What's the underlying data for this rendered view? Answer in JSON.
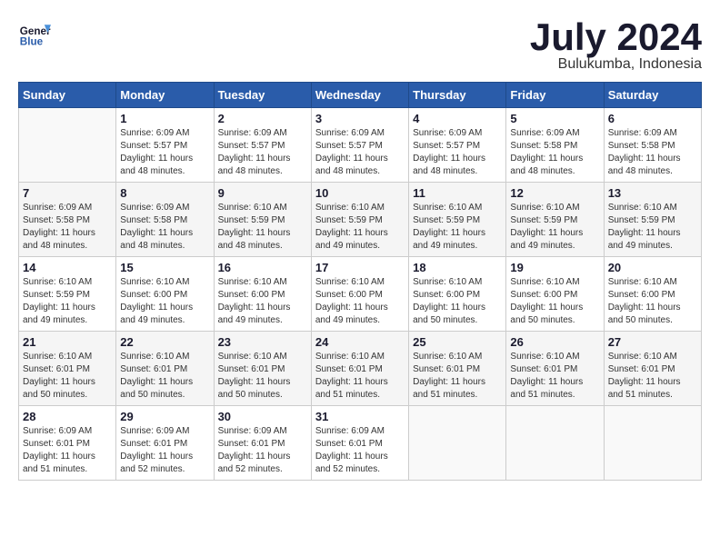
{
  "header": {
    "logo_line1": "General",
    "logo_line2": "Blue",
    "month": "July 2024",
    "location": "Bulukumba, Indonesia"
  },
  "weekdays": [
    "Sunday",
    "Monday",
    "Tuesday",
    "Wednesday",
    "Thursday",
    "Friday",
    "Saturday"
  ],
  "weeks": [
    [
      {
        "day": "",
        "info": ""
      },
      {
        "day": "1",
        "info": "Sunrise: 6:09 AM\nSunset: 5:57 PM\nDaylight: 11 hours\nand 48 minutes."
      },
      {
        "day": "2",
        "info": "Sunrise: 6:09 AM\nSunset: 5:57 PM\nDaylight: 11 hours\nand 48 minutes."
      },
      {
        "day": "3",
        "info": "Sunrise: 6:09 AM\nSunset: 5:57 PM\nDaylight: 11 hours\nand 48 minutes."
      },
      {
        "day": "4",
        "info": "Sunrise: 6:09 AM\nSunset: 5:57 PM\nDaylight: 11 hours\nand 48 minutes."
      },
      {
        "day": "5",
        "info": "Sunrise: 6:09 AM\nSunset: 5:58 PM\nDaylight: 11 hours\nand 48 minutes."
      },
      {
        "day": "6",
        "info": "Sunrise: 6:09 AM\nSunset: 5:58 PM\nDaylight: 11 hours\nand 48 minutes."
      }
    ],
    [
      {
        "day": "7",
        "info": "Sunrise: 6:09 AM\nSunset: 5:58 PM\nDaylight: 11 hours\nand 48 minutes."
      },
      {
        "day": "8",
        "info": "Sunrise: 6:09 AM\nSunset: 5:58 PM\nDaylight: 11 hours\nand 48 minutes."
      },
      {
        "day": "9",
        "info": "Sunrise: 6:10 AM\nSunset: 5:59 PM\nDaylight: 11 hours\nand 48 minutes."
      },
      {
        "day": "10",
        "info": "Sunrise: 6:10 AM\nSunset: 5:59 PM\nDaylight: 11 hours\nand 49 minutes."
      },
      {
        "day": "11",
        "info": "Sunrise: 6:10 AM\nSunset: 5:59 PM\nDaylight: 11 hours\nand 49 minutes."
      },
      {
        "day": "12",
        "info": "Sunrise: 6:10 AM\nSunset: 5:59 PM\nDaylight: 11 hours\nand 49 minutes."
      },
      {
        "day": "13",
        "info": "Sunrise: 6:10 AM\nSunset: 5:59 PM\nDaylight: 11 hours\nand 49 minutes."
      }
    ],
    [
      {
        "day": "14",
        "info": "Sunrise: 6:10 AM\nSunset: 5:59 PM\nDaylight: 11 hours\nand 49 minutes."
      },
      {
        "day": "15",
        "info": "Sunrise: 6:10 AM\nSunset: 6:00 PM\nDaylight: 11 hours\nand 49 minutes."
      },
      {
        "day": "16",
        "info": "Sunrise: 6:10 AM\nSunset: 6:00 PM\nDaylight: 11 hours\nand 49 minutes."
      },
      {
        "day": "17",
        "info": "Sunrise: 6:10 AM\nSunset: 6:00 PM\nDaylight: 11 hours\nand 49 minutes."
      },
      {
        "day": "18",
        "info": "Sunrise: 6:10 AM\nSunset: 6:00 PM\nDaylight: 11 hours\nand 50 minutes."
      },
      {
        "day": "19",
        "info": "Sunrise: 6:10 AM\nSunset: 6:00 PM\nDaylight: 11 hours\nand 50 minutes."
      },
      {
        "day": "20",
        "info": "Sunrise: 6:10 AM\nSunset: 6:00 PM\nDaylight: 11 hours\nand 50 minutes."
      }
    ],
    [
      {
        "day": "21",
        "info": "Sunrise: 6:10 AM\nSunset: 6:01 PM\nDaylight: 11 hours\nand 50 minutes."
      },
      {
        "day": "22",
        "info": "Sunrise: 6:10 AM\nSunset: 6:01 PM\nDaylight: 11 hours\nand 50 minutes."
      },
      {
        "day": "23",
        "info": "Sunrise: 6:10 AM\nSunset: 6:01 PM\nDaylight: 11 hours\nand 50 minutes."
      },
      {
        "day": "24",
        "info": "Sunrise: 6:10 AM\nSunset: 6:01 PM\nDaylight: 11 hours\nand 51 minutes."
      },
      {
        "day": "25",
        "info": "Sunrise: 6:10 AM\nSunset: 6:01 PM\nDaylight: 11 hours\nand 51 minutes."
      },
      {
        "day": "26",
        "info": "Sunrise: 6:10 AM\nSunset: 6:01 PM\nDaylight: 11 hours\nand 51 minutes."
      },
      {
        "day": "27",
        "info": "Sunrise: 6:10 AM\nSunset: 6:01 PM\nDaylight: 11 hours\nand 51 minutes."
      }
    ],
    [
      {
        "day": "28",
        "info": "Sunrise: 6:09 AM\nSunset: 6:01 PM\nDaylight: 11 hours\nand 51 minutes."
      },
      {
        "day": "29",
        "info": "Sunrise: 6:09 AM\nSunset: 6:01 PM\nDaylight: 11 hours\nand 52 minutes."
      },
      {
        "day": "30",
        "info": "Sunrise: 6:09 AM\nSunset: 6:01 PM\nDaylight: 11 hours\nand 52 minutes."
      },
      {
        "day": "31",
        "info": "Sunrise: 6:09 AM\nSunset: 6:01 PM\nDaylight: 11 hours\nand 52 minutes."
      },
      {
        "day": "",
        "info": ""
      },
      {
        "day": "",
        "info": ""
      },
      {
        "day": "",
        "info": ""
      }
    ]
  ]
}
